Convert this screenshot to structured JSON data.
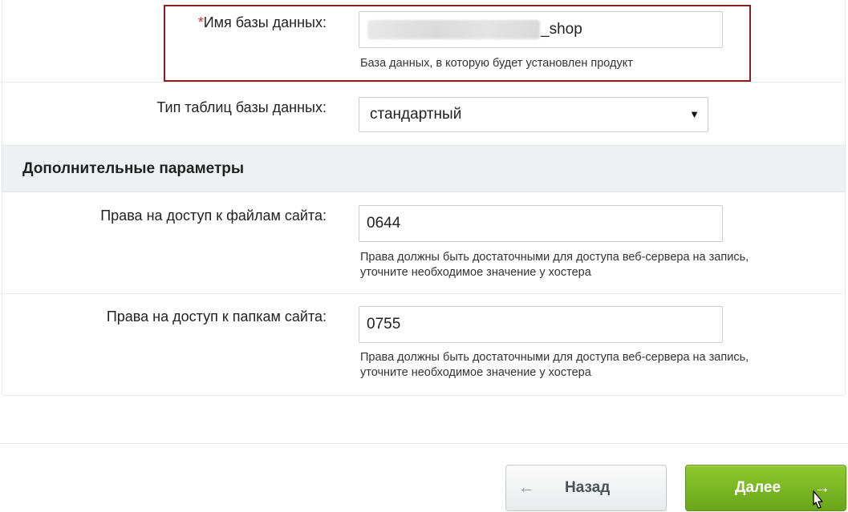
{
  "db": {
    "required_mark": "*",
    "name_label": "Имя базы данных:",
    "name_value_suffix": "_shop",
    "name_hint": "База данных, в которую будет установлен продукт",
    "table_type_label": "Тип таблиц базы данных:",
    "table_type_value": "стандартный"
  },
  "advanced": {
    "title": "Дополнительные параметры",
    "files_label": "Права на доступ к файлам сайта:",
    "files_value": "0644",
    "files_hint_line1": "Права должны быть достаточными для доступа веб-сервера на запись,",
    "files_hint_line2": "уточните необходимое значение у хостера",
    "folders_label": "Права на доступ к папкам сайта:",
    "folders_value": "0755",
    "folders_hint_line1": "Права должны быть достаточными для доступа веб-сервера на запись,",
    "folders_hint_line2": "уточните необходимое значение у хостера"
  },
  "buttons": {
    "back_arrow": "←",
    "back_label": "Назад",
    "next_label": "Далее",
    "next_arrow": "→"
  },
  "colors": {
    "required": "#c0392b",
    "highlight_border": "#8c1d1d",
    "next_button": "#7ab827",
    "section_bg": "#eef1f2"
  }
}
